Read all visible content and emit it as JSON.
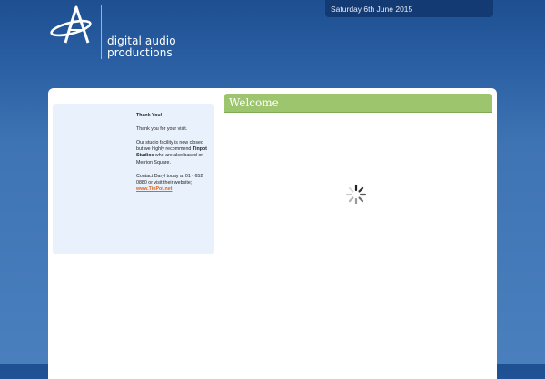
{
  "header": {
    "date": "Saturday 6th June 2015",
    "logo_line1": "digital audio",
    "logo_line2": "productions"
  },
  "sidebar": {
    "title": "Thank You!",
    "para1": "Thank you for your visit.",
    "para2_pre": "Our studio facility is now closed but we highly recommend",
    "para2_bold": "Tinpot Studios",
    "para2_post": "who are also based on Merrion Square.",
    "para3": "Contact Daryl today at 01 - 652 0880 or visit their website;",
    "link_text": "www.TinPot.net",
    "link_color": "#e0641c"
  },
  "main": {
    "welcome_title": "Welcome",
    "welcome_color": "#9cc56d",
    "loading_icon": "spinner-icon"
  }
}
